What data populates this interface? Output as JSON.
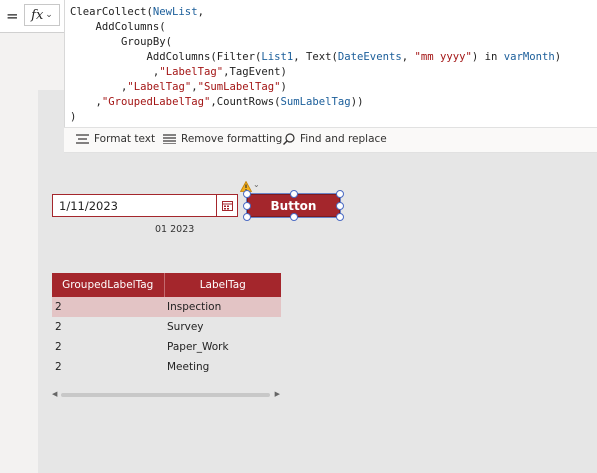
{
  "formula_bar": {
    "equals": "=",
    "fx_label": "fx",
    "code": {
      "l1_fn": "ClearCollect(",
      "l1_id": "NewList",
      "l1_end": ",",
      "l2_fn": "AddColumns(",
      "l3_fn": "GroupBy(",
      "l4_fn1": "AddColumns(",
      "l4_fn2": "Filter(",
      "l4_id1": "List1",
      "l4_sep1": ", ",
      "l4_fn3": "Text(",
      "l4_id2": "DateEvents",
      "l4_sep2": ", ",
      "l4_str": "\"mm yyyy\"",
      "l4_rest": ") in ",
      "l4_id3": "varMonth",
      "l4_end": ")",
      "l5_pre": ",",
      "l5_str": "\"LabelTag\"",
      "l5_rest": ",TagEvent)",
      "l6_pre": ",",
      "l6_str1": "\"LabelTag\"",
      "l6_sep": ",",
      "l6_str2": "\"SumLabelTag\"",
      "l6_end": ")",
      "l7_pre": ",",
      "l7_str": "\"GroupedLabelTag\"",
      "l7_mid": ",",
      "l7_fn": "CountRows(",
      "l7_id": "SumLabelTag",
      "l7_end": "))",
      "l8": ")"
    }
  },
  "toolbar": {
    "format_text": "Format text",
    "remove_formatting": "Remove formatting",
    "find_replace": "Find and replace"
  },
  "datepicker": {
    "value": "1/11/2023"
  },
  "month_label": "01 2023",
  "button": {
    "label": "Button"
  },
  "table": {
    "headers": [
      "GroupedLabelTag",
      "LabelTag"
    ],
    "rows": [
      {
        "count": "2",
        "tag": "Inspection"
      },
      {
        "count": "2",
        "tag": "Survey"
      },
      {
        "count": "2",
        "tag": "Paper_Work"
      },
      {
        "count": "2",
        "tag": "Meeting"
      }
    ]
  },
  "colors": {
    "accent": "#a4262c",
    "selection": "#4b6bc4",
    "row_selected": "#e3c4c5"
  }
}
